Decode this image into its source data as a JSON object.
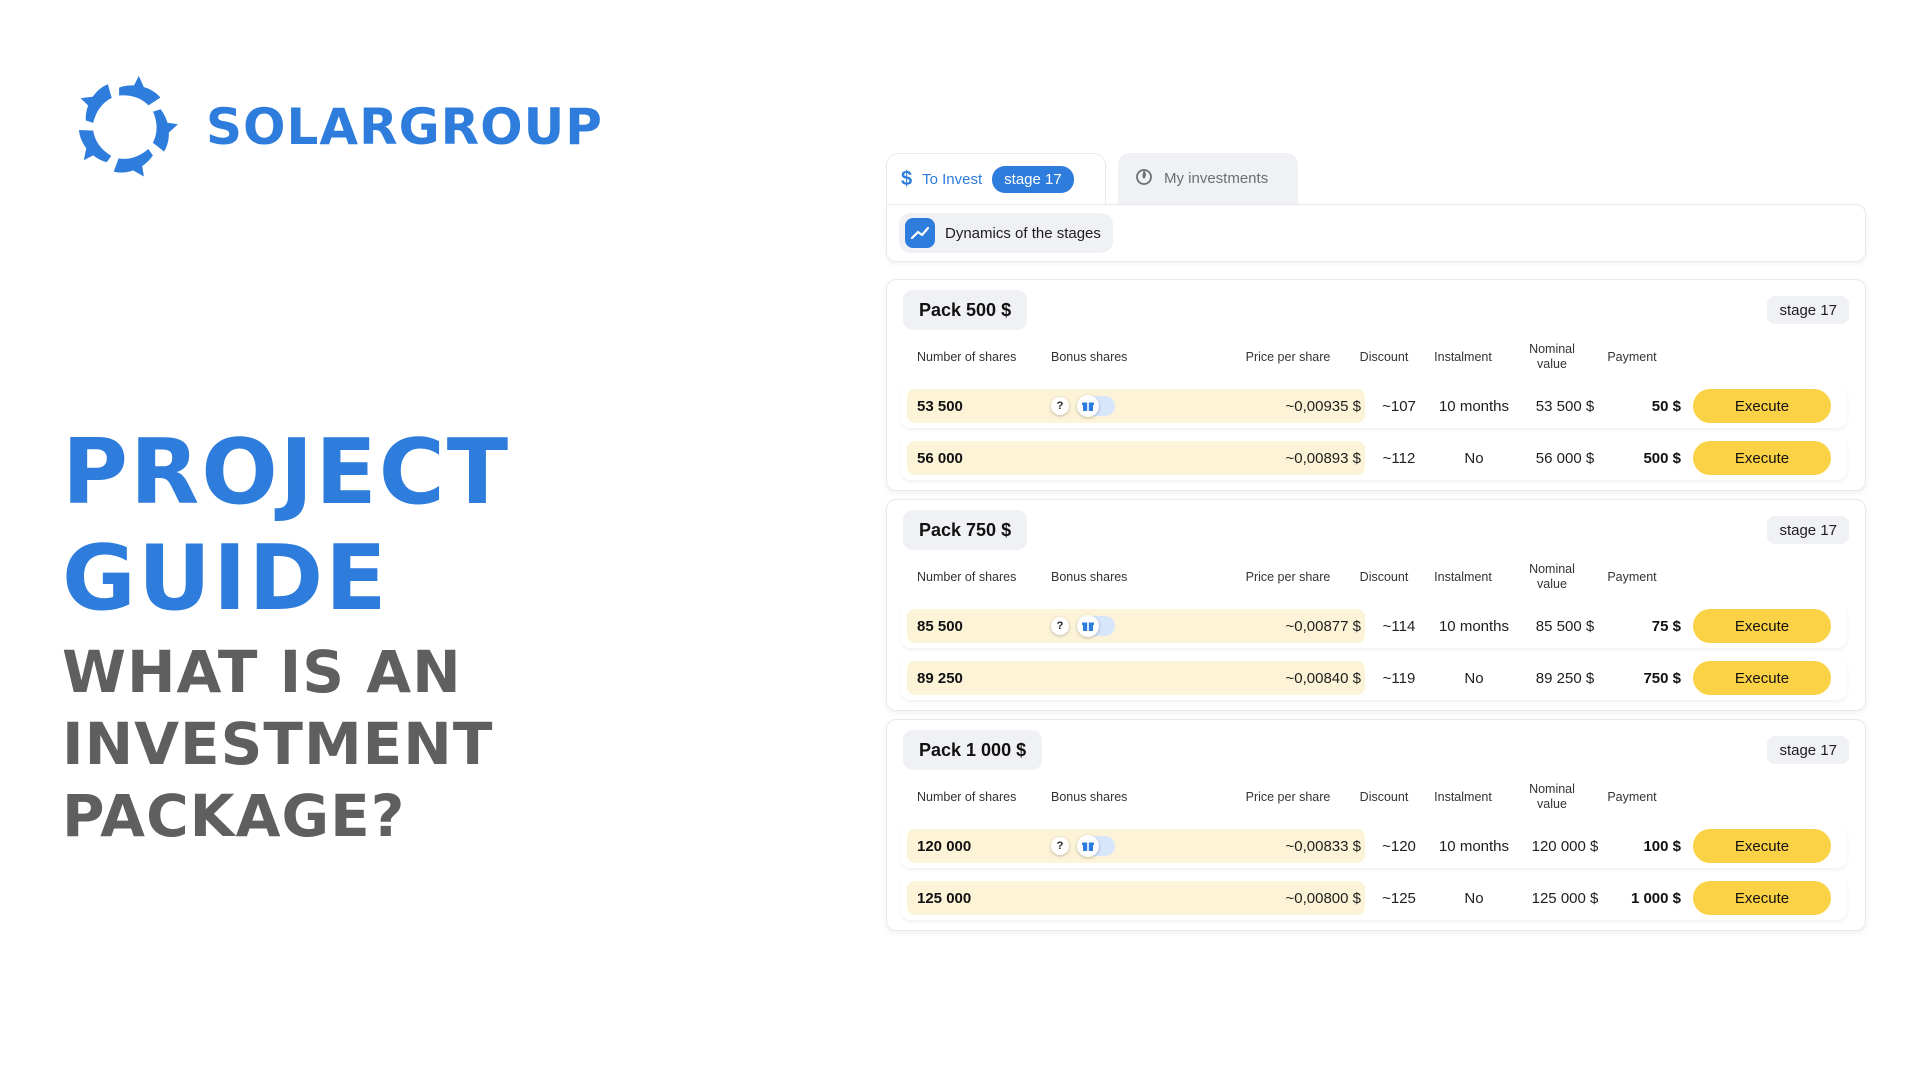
{
  "brand": {
    "name": "SOLARGROUP",
    "color": "#2e7ddc"
  },
  "headline": {
    "line1": "PROJECT",
    "line2": "GUIDE",
    "sub1": "WHAT IS AN",
    "sub2": "INVESTMENT",
    "sub3": "PACKAGE?"
  },
  "tabs": {
    "invest_icon": "dollar-icon",
    "invest_label": "To Invest",
    "invest_badge": "stage 17",
    "mine_icon": "fire-badge-icon",
    "mine_label": "My investments"
  },
  "dynamics": {
    "icon": "trend-chart-icon",
    "label": "Dynamics of the stages"
  },
  "columns": {
    "shares": "Number of shares",
    "bonus": "Bonus shares",
    "price": "Price per share",
    "discount": "Discount",
    "instalment": "Instalment",
    "nominal": "Nominal value",
    "payment": "Payment"
  },
  "execute_label": "Execute",
  "packs": [
    {
      "title": "Pack 500 $",
      "stage": "stage 17",
      "rows": [
        {
          "shares": "53 500",
          "bonus": true,
          "price": "~0,00935 $",
          "discount": "~107",
          "instalment": "10 months",
          "nominal": "53 500 $",
          "payment": "50 $"
        },
        {
          "shares": "56 000",
          "bonus": false,
          "price": "~0,00893 $",
          "discount": "~112",
          "instalment": "No",
          "nominal": "56 000 $",
          "payment": "500 $"
        }
      ]
    },
    {
      "title": "Pack 750 $",
      "stage": "stage 17",
      "rows": [
        {
          "shares": "85 500",
          "bonus": true,
          "price": "~0,00877 $",
          "discount": "~114",
          "instalment": "10 months",
          "nominal": "85 500 $",
          "payment": "75 $"
        },
        {
          "shares": "89 250",
          "bonus": false,
          "price": "~0,00840 $",
          "discount": "~119",
          "instalment": "No",
          "nominal": "89 250 $",
          "payment": "750 $"
        }
      ]
    },
    {
      "title": "Pack 1 000 $",
      "stage": "stage 17",
      "rows": [
        {
          "shares": "120 000",
          "bonus": true,
          "price": "~0,00833 $",
          "discount": "~120",
          "instalment": "10 months",
          "nominal": "120 000 $",
          "payment": "100 $"
        },
        {
          "shares": "125 000",
          "bonus": false,
          "price": "~0,00800 $",
          "discount": "~125",
          "instalment": "No",
          "nominal": "125 000 $",
          "payment": "1 000 $"
        }
      ]
    }
  ]
}
